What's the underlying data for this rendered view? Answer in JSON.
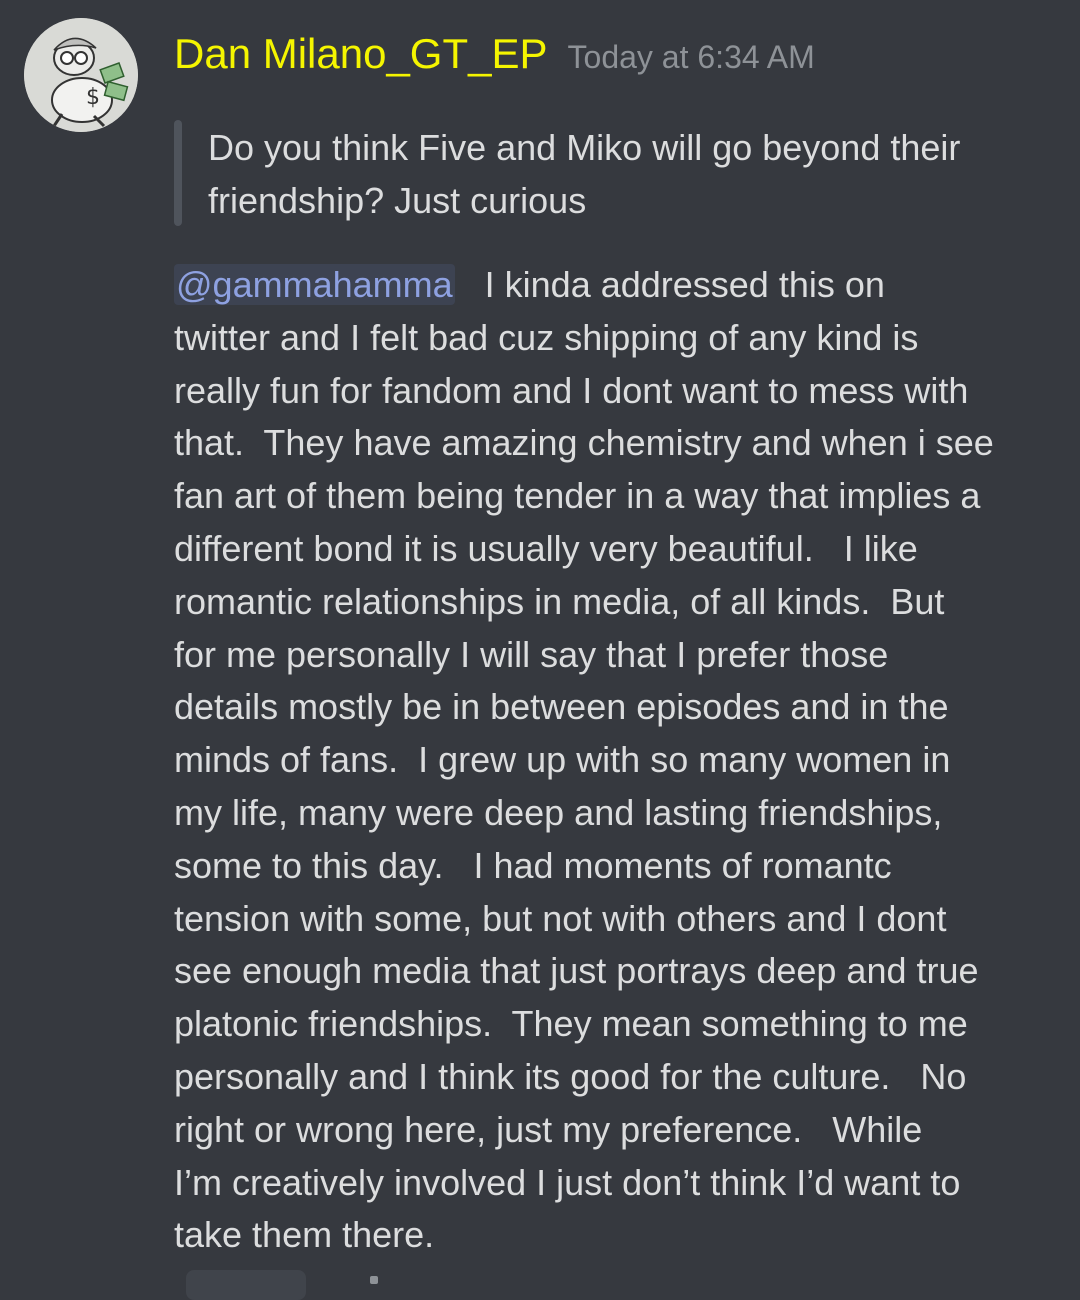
{
  "message": {
    "author": "Dan Milano_GT_EP",
    "timestamp": "Today at 6:34 AM",
    "avatar_icon": "cartoon-character-avatar",
    "quote_lines": [
      "Do you think Five and Miko will go beyond their",
      "friendship? Just curious"
    ],
    "mention": "@gammahamma",
    "body_lines": [
      "   I kinda addressed this on",
      "twitter and I felt bad cuz shipping of any kind is",
      "really fun for fandom and I dont want to mess with",
      "that.  They have amazing chemistry and when i see",
      "fan art of them being tender in a way that implies a",
      "different bond it is usually very beautiful.   I like",
      "romantic relationships in media, of all kinds.  But",
      "for me personally I will say that I prefer those",
      "details mostly be in between episodes and in the",
      "minds of fans.  I grew up with so many women in",
      "my life, many were deep and lasting friendships,",
      "some to this day.   I had moments of romantc",
      "tension with some, but not with others and I dont",
      "see enough media that just portrays deep and true",
      "platonic friendships.  They mean something to me",
      "personally and I think its good for the culture.   No",
      "right or wrong here, just my preference.   While",
      "I’m creatively involved I just don’t think I’d want to",
      "take them there."
    ]
  },
  "colors": {
    "background": "#36393f",
    "username": "#f5f500",
    "timestamp": "#8e9297",
    "text": "#dcddde",
    "mention": "#8ea1e1",
    "quote_bar": "#4f545c"
  }
}
